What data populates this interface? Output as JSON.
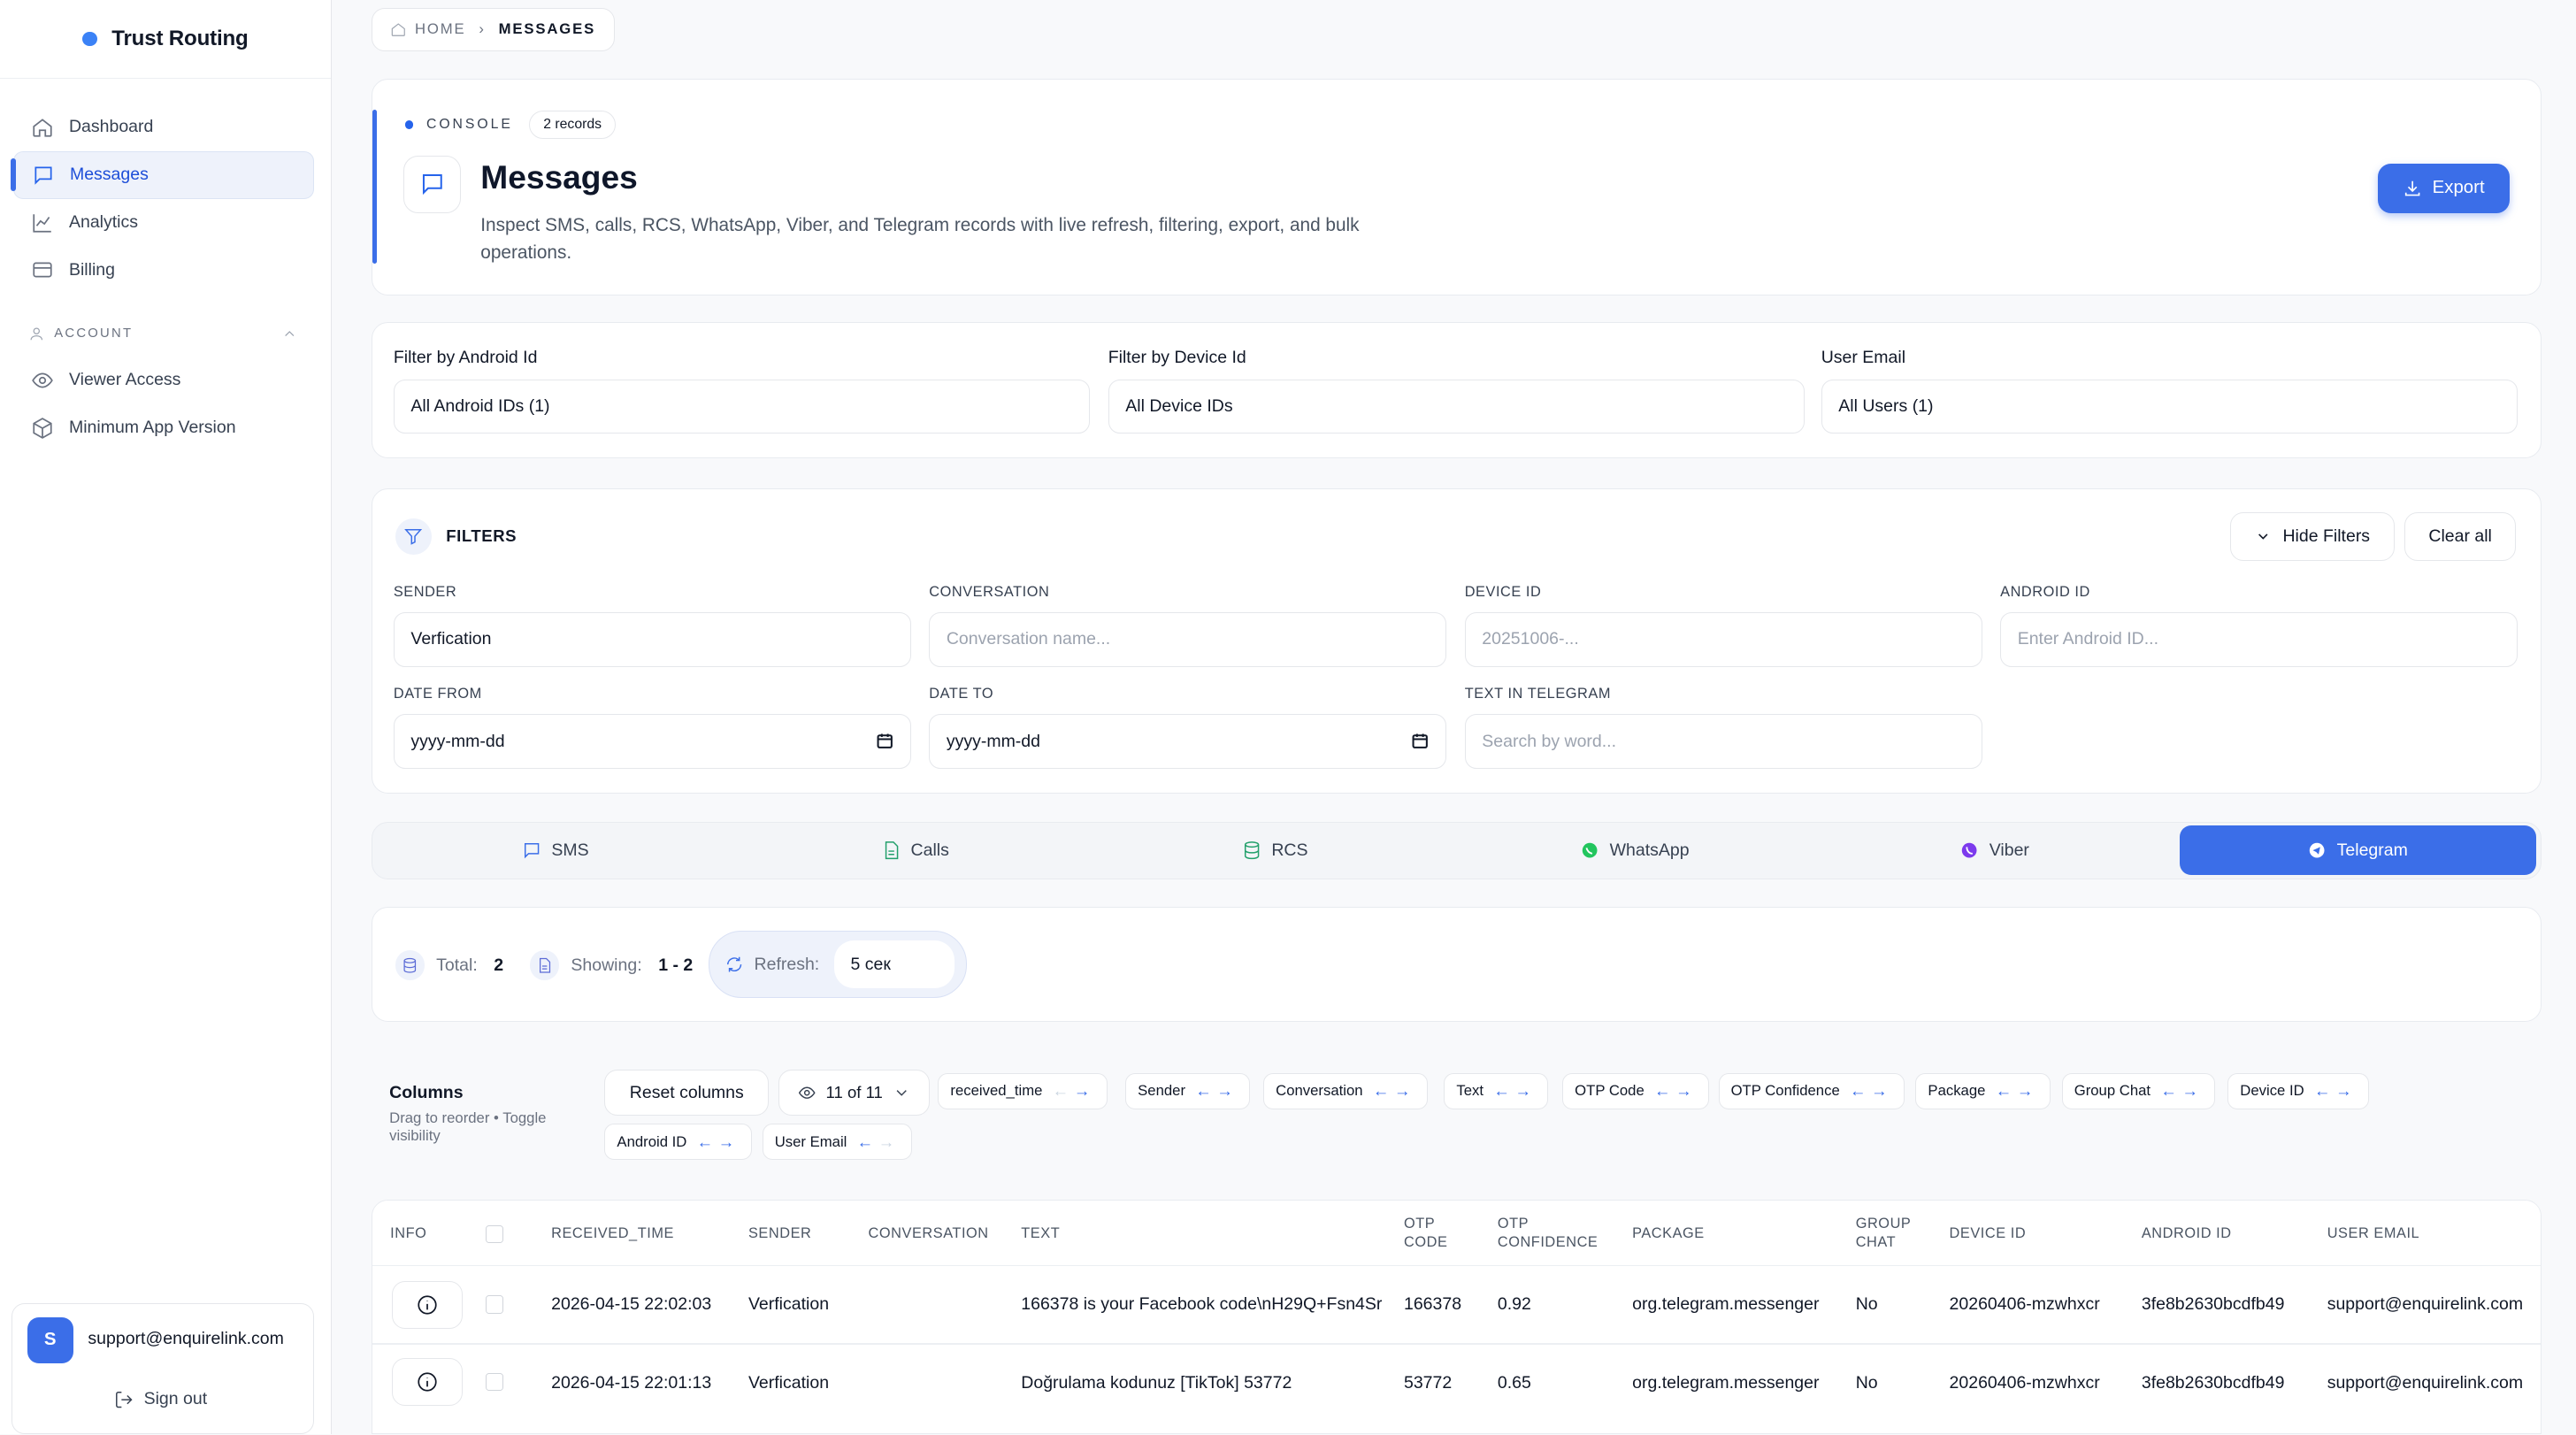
{
  "app": {
    "name": "Trust Routing"
  },
  "sidebar": {
    "items": [
      {
        "label": "Dashboard",
        "icon": "home-icon"
      },
      {
        "label": "Messages",
        "icon": "message-icon",
        "active": true
      },
      {
        "label": "Analytics",
        "icon": "chart-icon"
      },
      {
        "label": "Billing",
        "icon": "card-icon"
      }
    ],
    "account_label": "ACCOUNT",
    "account_items": [
      {
        "label": "Viewer Access",
        "icon": "eye-icon"
      },
      {
        "label": "Minimum App Version",
        "icon": "package-icon"
      }
    ],
    "user": {
      "initial": "S",
      "email": "support@enquirelink.com",
      "signout": "Sign out"
    }
  },
  "breadcrumb": {
    "home": "HOME",
    "current": "MESSAGES"
  },
  "hero": {
    "console": "CONSOLE",
    "records": "2 records",
    "title": "Messages",
    "description": "Inspect SMS, calls, RCS, WhatsApp, Viber, and Telegram records with live refresh, filtering, export, and bulk operations.",
    "export": "Export"
  },
  "top_filters": [
    {
      "label": "Filter by Android Id",
      "value": "All Android IDs (1)"
    },
    {
      "label": "Filter by Device Id",
      "value": "All Device IDs"
    },
    {
      "label": "User Email",
      "value": "All Users (1)"
    }
  ],
  "filters": {
    "title": "FILTERS",
    "hide": "Hide Filters",
    "clear": "Clear all",
    "fields": [
      {
        "label": "SENDER",
        "value": "Verfication",
        "placeholder": ""
      },
      {
        "label": "CONVERSATION",
        "value": "",
        "placeholder": "Conversation name..."
      },
      {
        "label": "DEVICE ID",
        "value": "",
        "placeholder": "20251006-..."
      },
      {
        "label": "ANDROID ID",
        "value": "",
        "placeholder": "Enter Android ID..."
      },
      {
        "label": "DATE FROM",
        "value": "yyyy-mm-dd",
        "placeholder": ""
      },
      {
        "label": "DATE TO",
        "value": "yyyy-mm-dd",
        "placeholder": ""
      },
      {
        "label": "TEXT IN TELEGRAM",
        "value": "",
        "placeholder": "Search by word..."
      }
    ]
  },
  "tabs": [
    {
      "label": "SMS",
      "icon": "message-icon",
      "color": "#3b6ee8"
    },
    {
      "label": "Calls",
      "icon": "file-icon",
      "color": "#22a06b"
    },
    {
      "label": "RCS",
      "icon": "database-icon",
      "color": "#22a06b"
    },
    {
      "label": "WhatsApp",
      "icon": "whatsapp-icon",
      "color": "#22c55e"
    },
    {
      "label": "Viber",
      "icon": "viber-icon",
      "color": "#7c3aed"
    },
    {
      "label": "Telegram",
      "icon": "telegram-icon",
      "color": "#ffffff",
      "active": true
    }
  ],
  "stats": {
    "total_label": "Total:",
    "total": "2",
    "showing_label": "Showing:",
    "showing": "1 - 2",
    "refresh_label": "Refresh:",
    "refresh": "5 сек"
  },
  "columns": {
    "title": "Columns",
    "hint": "Drag to reorder • Toggle visibility",
    "reset": "Reset columns",
    "count": "11 of 11",
    "chips": [
      "received_time",
      "Sender",
      "Conversation",
      "Text",
      "OTP Code",
      "OTP Confidence",
      "Package",
      "Group Chat",
      "Device ID",
      "Android ID",
      "User Email"
    ]
  },
  "table": {
    "headers": [
      "INFO",
      "RECEIVED_TIME",
      "SENDER",
      "CONVERSATION",
      "TEXT",
      "OTP CODE",
      "OTP CONFIDENCE",
      "PACKAGE",
      "GROUP CHAT",
      "DEVICE ID",
      "ANDROID ID",
      "USER EMAIL"
    ],
    "rows": [
      {
        "received_time": "2026-04-15 22:02:03",
        "sender": "Verfication",
        "conversation": "",
        "text": "166378 is your Facebook code\\nH29Q+Fsn4Sr",
        "otp_code": "166378",
        "otp_confidence": "0.92",
        "package": "org.telegram.messenger",
        "group_chat": "No",
        "device_id": "20260406-mzwhxcr",
        "android_id": "3fe8b2630bcdfb49",
        "user_email": "support@enquirelink.com"
      },
      {
        "received_time": "2026-04-15 22:01:13",
        "sender": "Verfication",
        "conversation": "",
        "text": "Doğrulama kodunuz [TikTok] 53772",
        "otp_code": "53772",
        "otp_confidence": "0.65",
        "package": "org.telegram.messenger",
        "group_chat": "No",
        "device_id": "20260406-mzwhxcr",
        "android_id": "3fe8b2630bcdfb49",
        "user_email": "support@enquirelink.com"
      }
    ]
  }
}
